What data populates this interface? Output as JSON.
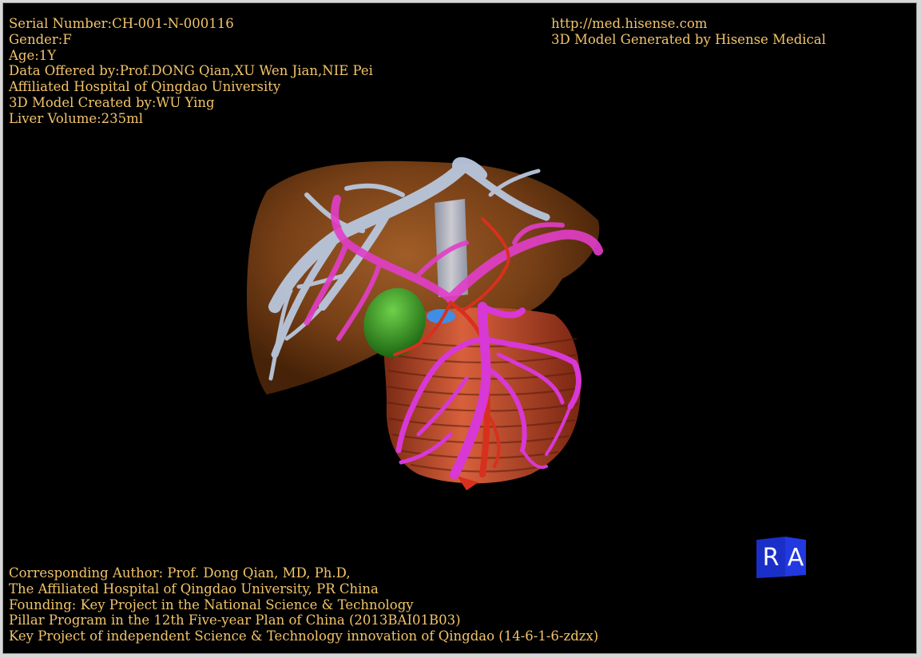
{
  "patient_info": {
    "serial_number": "Serial Number:CH-001-N-000116",
    "gender": "Gender:F",
    "age": "Age:1Y",
    "data_offered": "Data Offered by:Prof.DONG Qian,XU Wen Jian,NIE Pei",
    "hospital": "Affiliated Hospital of Qingdao University",
    "created_by": "3D Model Created by:WU Ying",
    "liver_volume": "Liver Volume:235ml"
  },
  "brand_info": {
    "url": "http://med.hisense.com",
    "generated_by": "3D Model Generated by Hisense Medical"
  },
  "credits": {
    "line1": "Corresponding Author: Prof. Dong Qian, MD, Ph.D,",
    "line2": "The Affiliated Hospital of Qingdao University, PR China",
    "line3": "Founding: Key Project in the National Science & Technology",
    "line4": "Pillar Program in the 12th Five-year Plan of China (2013BAI01B03)",
    "line5": "Key Project of independent Science & Technology innovation of Qingdao (14-6-1-6-zdzx)"
  },
  "orientation": {
    "left_label": "R",
    "right_label": "A"
  },
  "colors": {
    "text": "#f2c46a",
    "liver": "#8a4a1c",
    "hepatic_vein": "#b8c6dc",
    "portal_vein": "#e040c8",
    "artery": "#d83020",
    "gallbladder": "#3aa52a",
    "cube": "#1a2fc8"
  }
}
